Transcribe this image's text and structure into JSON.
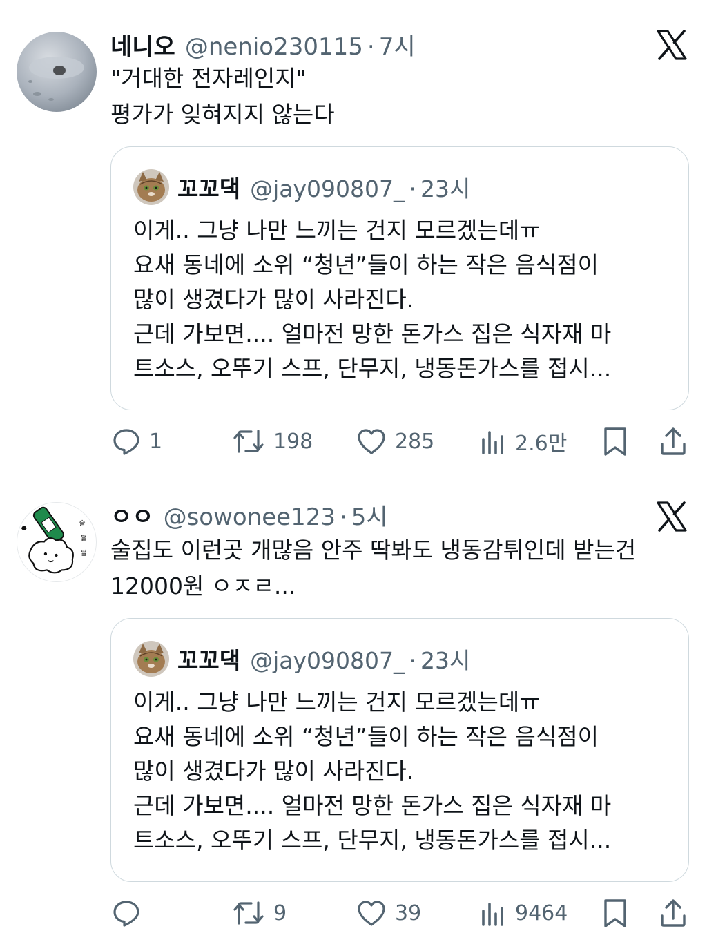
{
  "tweets": [
    {
      "name": "네니오",
      "handle": "@nenio230115",
      "separator": "·",
      "time": "7시",
      "text": "\"거대한 전자레인지\"\n평가가 잊혀지지 않는다",
      "quote": {
        "name": "꼬꼬댁",
        "handle": "@jay090807_",
        "separator": "·",
        "time": "23시",
        "text": "이게.. 그냥 나만 느끼는 건지 모르겠는데ㅠ\n요새 동네에 소위 “청년”들이 하는 작은 음식점이\n많이 생겼다가 많이 사라진다.\n근데 가보면.... 얼마전 망한 돈가스 집은 식자재 마\n트소스, 오뚜기 스프, 단무지, 냉동돈가스를 접시..."
      },
      "actions": {
        "replies": "1",
        "retweets": "198",
        "likes": "285",
        "views": "2.6만"
      }
    },
    {
      "name": "ㅇㅇ",
      "handle": "@sowonee123",
      "separator": "·",
      "time": "5시",
      "text": "술집도 이런곳 개많음 안주 딱봐도 냉동감튀인데 받는건\n12000원 ㅇㅈㄹ...",
      "quote": {
        "name": "꼬꼬댁",
        "handle": "@jay090807_",
        "separator": "·",
        "time": "23시",
        "text": "이게.. 그냥 나만 느끼는 건지 모르겠는데ㅠ\n요새 동네에 소위 “청년”들이 하는 작은 음식점이\n많이 생겼다가 많이 사라진다.\n근데 가보면.... 얼마전 망한 돈가스 집은 식자재 마\n트소스, 오뚜기 스프, 단무지, 냉동돈가스를 접시..."
      },
      "actions": {
        "replies": "",
        "retweets": "9",
        "likes": "39",
        "views": "9464"
      }
    }
  ],
  "icons": {
    "brand": "x-logo-icon",
    "reply": "reply-bubble-icon",
    "retweet": "retweet-icon",
    "like": "heart-icon",
    "views": "bar-chart-icon",
    "bookmark": "bookmark-icon",
    "share": "share-upload-icon"
  },
  "colors": {
    "text": "#0f1419",
    "secondary": "#536471",
    "border": "#cfd9de",
    "divider": "#e6e9eb"
  }
}
